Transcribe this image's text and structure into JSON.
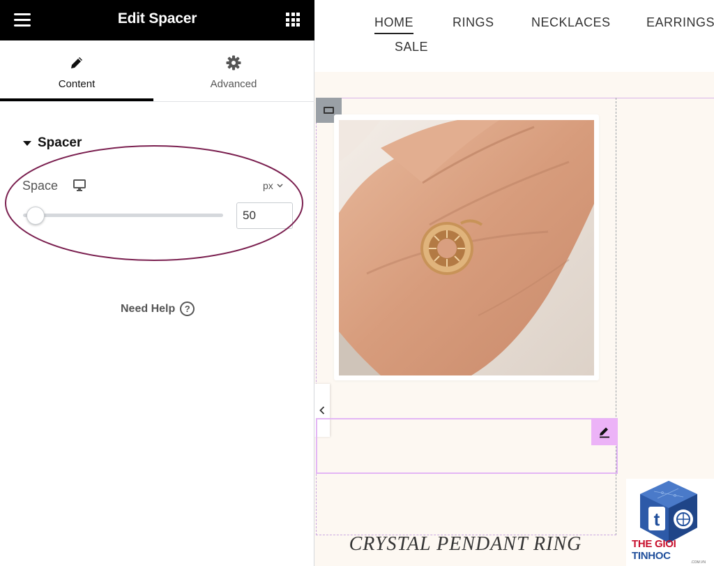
{
  "panel": {
    "title": "Edit Spacer",
    "tabs": [
      {
        "label": "Content",
        "icon": "pencil-icon",
        "active": true
      },
      {
        "label": "Advanced",
        "icon": "gear-icon",
        "active": false
      }
    ],
    "section_title": "Spacer",
    "space_control": {
      "label": "Space",
      "device_icon": "monitor-icon",
      "unit": "px",
      "value": "50",
      "slider_fraction": 0.05
    },
    "help_text": "Need Help",
    "help_icon": "?"
  },
  "preview": {
    "nav": [
      "HOME",
      "RINGS",
      "NECKLACES",
      "EARRINGS",
      "SALE"
    ],
    "active_nav": "HOME",
    "product_title": "CRYSTAL PENDANT RING"
  },
  "watermark": {
    "brand_part1": "THE GIOI",
    "brand_part2": "TINHOC",
    "domain": ".COM.VN"
  },
  "colors": {
    "panel_header_bg": "#000000",
    "preview_bg": "#fdf8f2",
    "spacer_outline": "#e3b6f5",
    "spacer_edit_bg": "#ecb3f7",
    "annotation_ellipse": "#7a1f4f"
  }
}
